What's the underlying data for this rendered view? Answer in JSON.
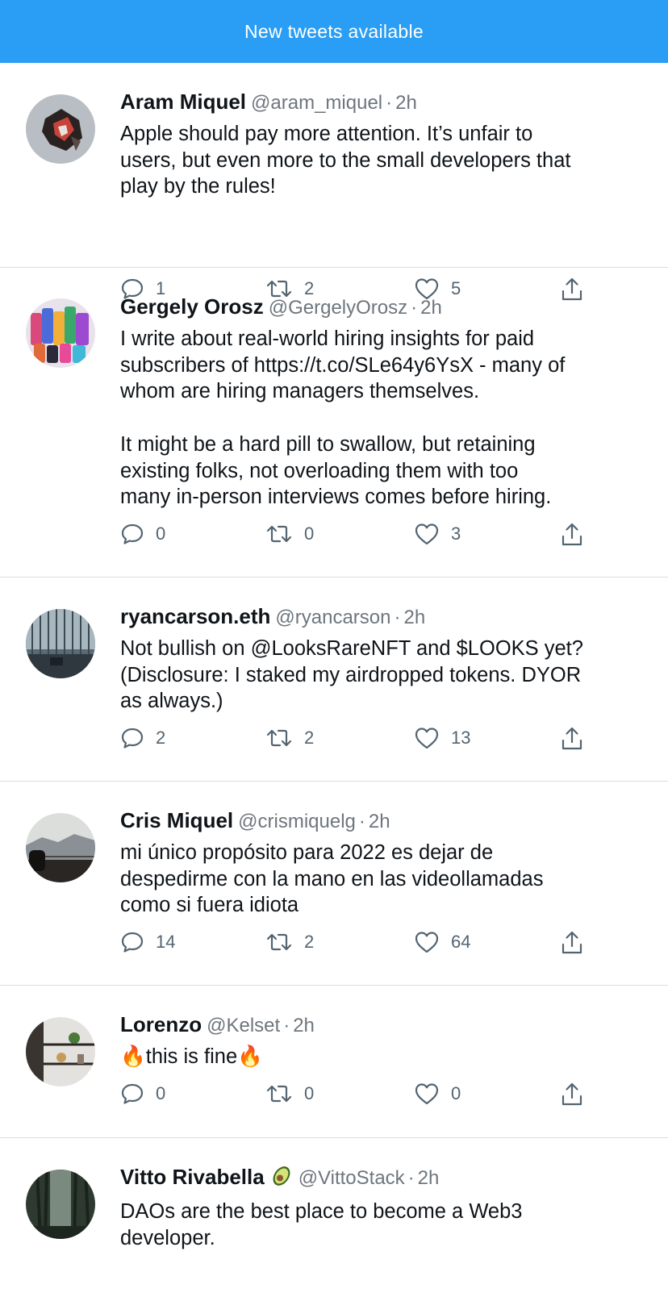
{
  "banner": {
    "label": "New tweets available"
  },
  "colors": {
    "banner": "#2a9df4",
    "muted": "#6e767d",
    "divider": "#d9dde1"
  },
  "tweets": [
    {
      "name": "Aram Miquel",
      "handle": "@aram_miquel",
      "time": "2h",
      "text": "Apple should pay more attention. It’s unfair to\nusers, but even more to the small developers that\nplay by the rules!",
      "replies": "1",
      "retweets": "2",
      "likes": "5",
      "avatar": "abstract-artwork"
    },
    {
      "name": "Gergely Orosz",
      "handle": "@GergelyOrosz",
      "time": "2h",
      "text": "I write about real-world hiring insights for paid\nsubscribers of https://t.co/SLe64y6YsX - many of\nwhom are hiring managers themselves.\n\nIt might be a hard pill to swallow, but retaining\nexisting folks, not overloading them with too\nmany in-person interviews comes before hiring.",
      "replies": "0",
      "retweets": "0",
      "likes": "3",
      "avatar": "colorful-cans"
    },
    {
      "name": "ryancarson.eth",
      "handle": "@ryancarson",
      "time": "2h",
      "text": "Not bullish on @LooksRareNFT and $LOOKS yet?\n(Disclosure: I staked my airdropped tokens. DYOR\nas always.)",
      "replies": "2",
      "retweets": "2",
      "likes": "13",
      "avatar": "glass-building"
    },
    {
      "name": "Cris Miquel",
      "handle": "@crismiquelg",
      "time": "2h",
      "text": "mi único propósito para 2022 es dejar de\ndespedirme con la mano en las videollamadas\ncomo si fuera idiota",
      "replies": "14",
      "retweets": "2",
      "likes": "64",
      "avatar": "landscape-person"
    },
    {
      "name": "Lorenzo",
      "handle": "@Kelset",
      "time": "2h",
      "text": "🔥this is fine🔥",
      "replies": "0",
      "retweets": "0",
      "likes": "0",
      "avatar": "shelf-interior"
    },
    {
      "name": "Vitto Rivabella",
      "name_emoji": "avocado",
      "handle": "@VittoStack",
      "time": "2h",
      "text": "DAOs are the best place to become a Web3\ndeveloper.",
      "avatar": "forest"
    }
  ]
}
